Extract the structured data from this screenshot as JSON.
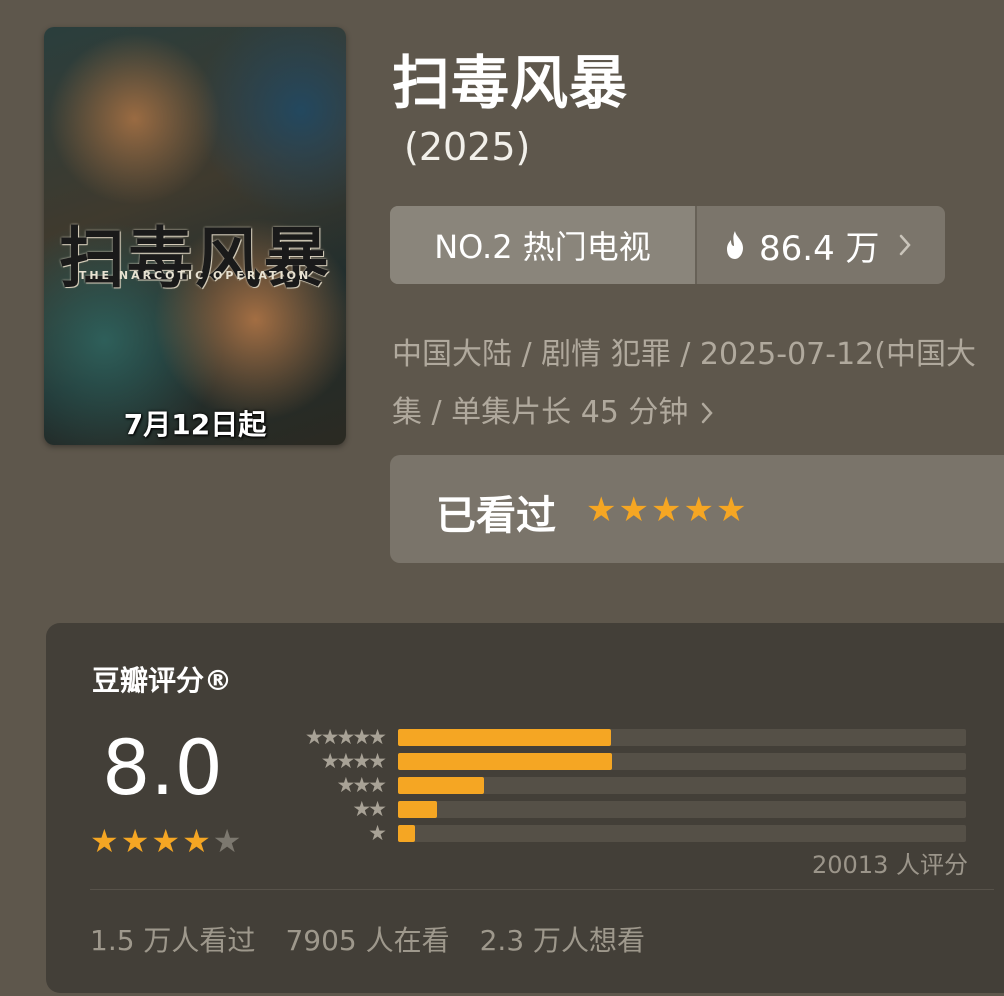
{
  "poster": {
    "title_text": "扫毒风暴",
    "subtitle_text": "THE NARCOTIC OPERATION",
    "release_badge": "7月12日起"
  },
  "title": "扫毒风暴",
  "year": "(2025)",
  "rank": {
    "label": "NO.2 热门电视",
    "heat_value": "86.4 万",
    "icon": "fire-icon"
  },
  "meta": {
    "line1": "中国大陆 / 剧情 犯罪 / 2025-07-12(中国大",
    "line2": "集 / 单集片长 45 分钟"
  },
  "user_status": {
    "label": "已看过",
    "stars": 5
  },
  "rating": {
    "title": "豆瓣评分®",
    "score": "8.0",
    "stars_filled": 4,
    "stars_total": 5,
    "distribution": [
      {
        "stars": "★★★★★",
        "fraction": 0.375
      },
      {
        "stars": "★★★★",
        "fraction": 0.377
      },
      {
        "stars": "★★★",
        "fraction": 0.152
      },
      {
        "stars": "★★",
        "fraction": 0.068
      },
      {
        "stars": "★",
        "fraction": 0.03
      }
    ],
    "votes": "20013 人评分",
    "stats": {
      "watched": "1.5 万人看过",
      "watching": "7905 人在看",
      "want": "2.3 万人想看"
    }
  },
  "colors": {
    "accent_star": "#f5a623",
    "background": "#5e574c"
  }
}
